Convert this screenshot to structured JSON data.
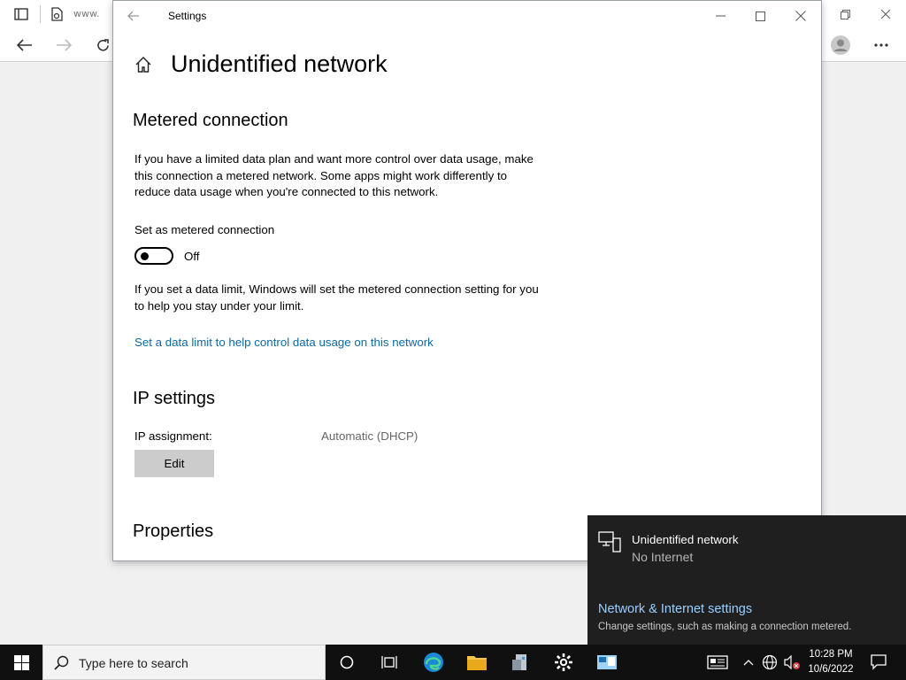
{
  "browser": {
    "tab_text": "www."
  },
  "settings": {
    "window_title": "Settings",
    "page_title": "Unidentified network",
    "metered": {
      "heading": "Metered connection",
      "description": "If you have a limited data plan and want more control over data usage, make this connection a metered network. Some apps might work differently to reduce data usage when you're connected to this network.",
      "toggle_label": "Set as metered connection",
      "toggle_state": "Off",
      "data_limit_note": "If you set a data limit, Windows will set the metered connection setting for you to help you stay under your limit.",
      "data_limit_link": "Set a data limit to help control data usage on this network"
    },
    "ip": {
      "heading": "IP settings",
      "assignment_label": "IP assignment:",
      "assignment_value": "Automatic (DHCP)",
      "edit_label": "Edit"
    },
    "properties_heading": "Properties"
  },
  "flyout": {
    "network_name": "Unidentified network",
    "status": "No Internet",
    "settings_link": "Network & Internet settings",
    "settings_sub": "Change settings, such as making a connection metered."
  },
  "taskbar": {
    "search_placeholder": "Type here to search",
    "time": "10:28 PM",
    "date": "10/6/2022"
  },
  "colors": {
    "link": "#0b6aa2",
    "flyout_bg": "#1f1f1f",
    "flyout_link": "#99cfff",
    "taskbar_bg": "#101010"
  }
}
